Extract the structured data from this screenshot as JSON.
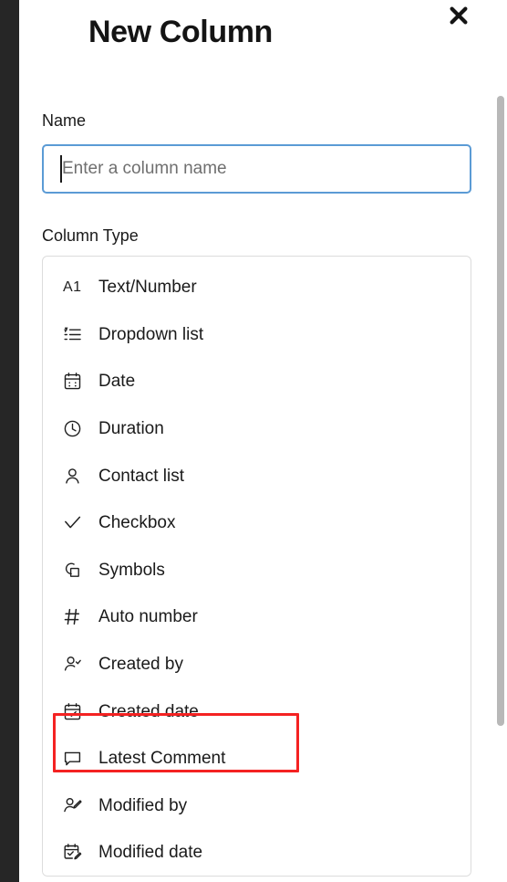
{
  "dialog": {
    "title": "New Column",
    "close_icon": "close-icon"
  },
  "form": {
    "name": {
      "label": "Name",
      "value": "",
      "placeholder": "Enter a column name",
      "focused": true,
      "focus_border_color": "#5b9bd5"
    },
    "column_type": {
      "label": "Column Type",
      "options": [
        {
          "label": "Text/Number",
          "icon": "a1-text-number-icon"
        },
        {
          "label": "Dropdown list",
          "icon": "bulleted-list-icon"
        },
        {
          "label": "Date",
          "icon": "calendar-icon"
        },
        {
          "label": "Duration",
          "icon": "clock-icon"
        },
        {
          "label": "Contact list",
          "icon": "person-icon"
        },
        {
          "label": "Checkbox",
          "icon": "checkmark-icon"
        },
        {
          "label": "Symbols",
          "icon": "circle-square-icon"
        },
        {
          "label": "Auto number",
          "icon": "hash-icon"
        },
        {
          "label": "Created by",
          "icon": "person-check-icon"
        },
        {
          "label": "Created date",
          "icon": "calendar-check-icon"
        },
        {
          "label": "Latest Comment",
          "icon": "comment-icon"
        },
        {
          "label": "Modified by",
          "icon": "person-pencil-icon"
        },
        {
          "label": "Modified date",
          "icon": "calendar-pencil-icon"
        }
      ],
      "highlighted_option": "Created by",
      "highlight_color": "#f42222"
    }
  },
  "chrome": {
    "left_rail_color": "#262626",
    "scrollbar_thumb_color": "#b8b8b8"
  }
}
